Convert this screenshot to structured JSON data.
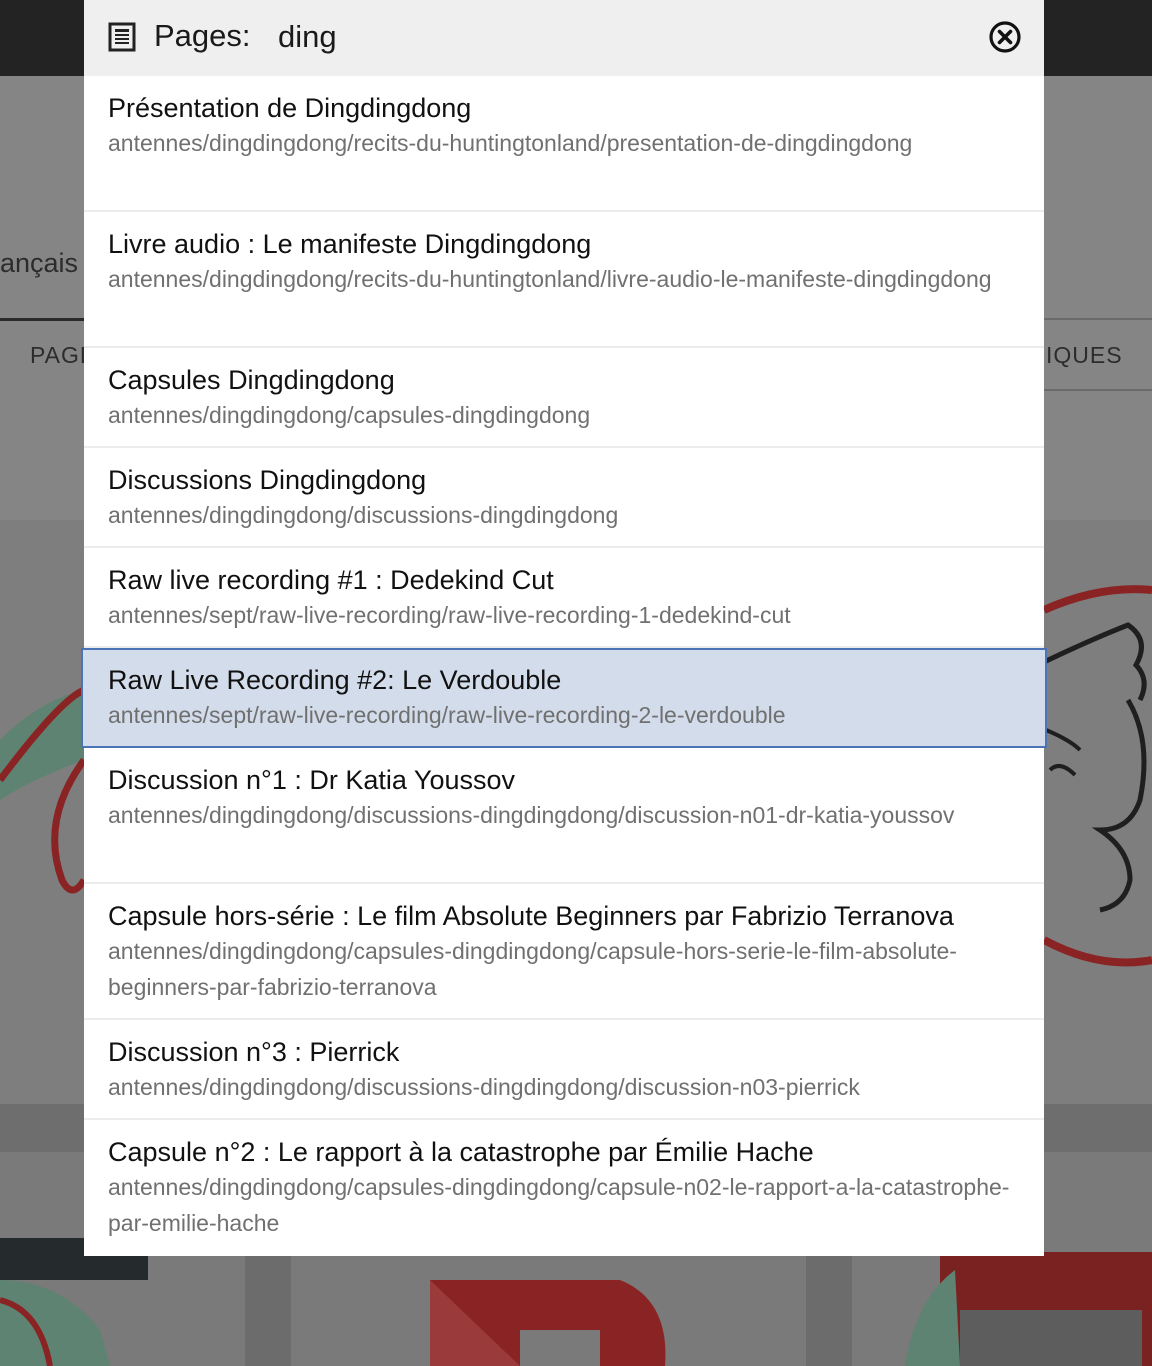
{
  "background": {
    "language_fragment": "ançais",
    "tab_left_fragment": "PAGE",
    "tab_right_fragment": "IQUES"
  },
  "search": {
    "label": "Pages:",
    "query": "ding",
    "icon": "page-icon",
    "close_icon": "close-circle-icon"
  },
  "results": [
    {
      "title": "Présentation de Dingdingdong",
      "path": "antennes/dingdingdong/recits-du-huntingtonland/presentation-de-dingdingdong"
    },
    {
      "title": "Livre audio : Le manifeste Dingdingdong",
      "path": "antennes/dingdingdong/recits-du-huntingtonland/livre-audio-le-manifeste-dingdingdong"
    },
    {
      "title": "Capsules Dingdingdong",
      "path": "antennes/dingdingdong/capsules-dingdingdong"
    },
    {
      "title": "Discussions Dingdingdong",
      "path": "antennes/dingdingdong/discussions-dingdingdong"
    },
    {
      "title": "Raw live recording #1 : Dedekind Cut",
      "path": "antennes/sept/raw-live-recording/raw-live-recording-1-dedekind-cut"
    },
    {
      "title": "Raw Live Recording #2: Le Verdouble",
      "path": "antennes/sept/raw-live-recording/raw-live-recording-2-le-verdouble",
      "selected": true
    },
    {
      "title": "Discussion n°1 : Dr Katia Youssov",
      "path": "antennes/dingdingdong/discussions-dingdingdong/discussion-n01-dr-katia-youssov"
    },
    {
      "title": "Capsule hors-série : Le film Absolute Beginners par Fabrizio Terranova",
      "path": "antennes/dingdingdong/capsules-dingdingdong/capsule-hors-serie-le-film-absolute-beginners-par-fabrizio-terranova"
    },
    {
      "title": "Discussion n°3 : Pierrick",
      "path": "antennes/dingdingdong/discussions-dingdingdong/discussion-n03-pierrick"
    },
    {
      "title": "Capsule n°2 : Le rapport à la catastrophe par Émilie Hache",
      "path": "antennes/dingdingdong/capsules-dingdingdong/capsule-n02-le-rapport-a-la-catastrophe-par-emilie-hache"
    }
  ],
  "colors": {
    "selected_background": "#d3dcea",
    "selected_border": "#4a73b8",
    "path_text": "#707070",
    "header_background": "#efefef"
  }
}
